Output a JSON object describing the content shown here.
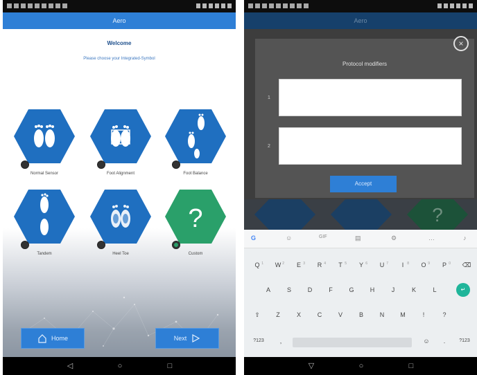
{
  "left": {
    "appbar_title": "Aero",
    "heading": "Welcome",
    "subheading": "Please choose your Integrated-Symbol",
    "items": [
      {
        "label": "Normal Sensor",
        "selected": false,
        "icon": "feet-icon"
      },
      {
        "label": "Foot Alignment",
        "selected": false,
        "icon": "feet-icon"
      },
      {
        "label": "Foot Balance",
        "selected": false,
        "icon": "foot-steps-icon"
      },
      {
        "label": "Tandem",
        "selected": false,
        "icon": "foot-tandem-icon"
      },
      {
        "label": "Heel Toe",
        "selected": false,
        "icon": "feet-heel-icon"
      },
      {
        "label": "Custom",
        "selected": true,
        "icon": "question-icon"
      }
    ],
    "home_label": "Home",
    "next_label": "Next",
    "colors": {
      "accent": "#2e7fd6",
      "hex_blue": "#1f6fc0",
      "hex_green": "#2aa06a"
    }
  },
  "right": {
    "appbar_title": "Aero",
    "dialog_title": "Protocol modifiers",
    "field1_label": "1",
    "field2_label": "2",
    "accept_label": "Accept",
    "keyboard": {
      "suggestion_icons": [
        "google-icon",
        "gif-icon",
        "clipboard-icon",
        "settings-icon",
        "more-icon",
        "mic-icon"
      ],
      "row1": [
        "Q",
        "W",
        "E",
        "R",
        "T",
        "Y",
        "U",
        "I",
        "O",
        "P"
      ],
      "row1_hints": [
        "1",
        "2",
        "3",
        "4",
        "5",
        "6",
        "7",
        "8",
        "9",
        "0"
      ],
      "row2": [
        "A",
        "S",
        "D",
        "F",
        "G",
        "H",
        "J",
        "K",
        "L"
      ],
      "row3": [
        "Z",
        "X",
        "C",
        "V",
        "B",
        "N",
        "M",
        "!",
        "?"
      ],
      "left_bottom": "?123",
      "right_bottom": "?123"
    }
  }
}
